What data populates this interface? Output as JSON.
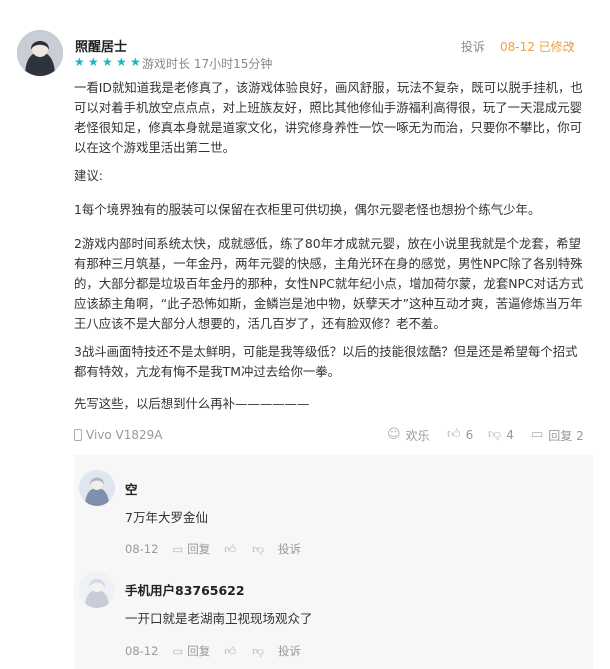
{
  "review": {
    "author": "照醒居士",
    "stars": 5,
    "playtime": "游戏时长 17小时15分钟",
    "report": "投诉",
    "date_modified": "08-12 已修改",
    "paragraphs": [
      "一看ID就知道我是老修真了，该游戏体验良好，画风舒服，玩法不复杂，既可以脱手挂机，也可以对着手机放空点点点，对上班族友好，照比其他修仙手游福利高得很，玩了一天混成元婴老怪很知足，修真本身就是道家文化，讲究修身养性一饮一啄无为而治，只要你不攀比，你可以在这个游戏里活出第二世。",
      "建议:",
      "1每个境界独有的服装可以保留在衣柜里可供切换，偶尔元婴老怪也想扮个练气少年。",
      "2游戏内部时间系统太快，成就感低，练了80年才成就元婴，放在小说里我就是个龙套，希望有那种三月筑基，一年金丹，两年元婴的快感，主角光环在身的感觉，男性NPC除了各别特殊的，大部分都是垃圾百年金丹的那种，女性NPC就年纪小点，增加荷尔蒙，龙套NPC对话方式应该舔主角啊，“此子恐怖如斯，金鳞岂是池中物，妖孽天才”这种互动才爽，苦逼修炼当万年王八应该不是大部分人想要的，活几百岁了，还有脸双修？老不羞。",
      "3战斗画面特技还不是太鲜明，可能是我等级低？以后的技能很炫酷？但是还是希望每个招式都有特效，亢龙有悔不是我TM冲过去给你一拳。",
      "先写这些，以后想到什么再补——————"
    ],
    "device": "Vivo V1829A",
    "actions": {
      "happy": "欢乐",
      "likes": "6",
      "dislikes": "4",
      "reply": "回复 2"
    }
  },
  "replies": [
    {
      "name": "空",
      "text": "7万年大罗金仙",
      "date": "08-12",
      "reply": "回复",
      "report": "投诉"
    },
    {
      "name": "手机用户83765622",
      "text": "一开口就是老湖南卫视现场观众了",
      "date": "08-12",
      "reply": "回复",
      "report": "投诉"
    }
  ],
  "colors": {
    "star": "#14b9c8",
    "accent_orange": "#f0a046",
    "reply_bg": "#f7f7f7"
  }
}
